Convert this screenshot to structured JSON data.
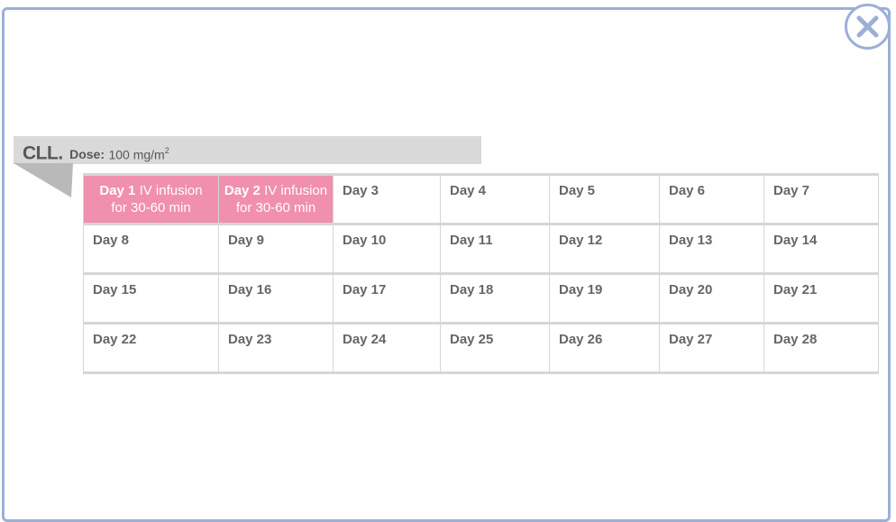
{
  "dialog": {
    "close_icon": "close-x-icon"
  },
  "banner": {
    "title": "CLL.",
    "dose_label": "Dose:",
    "dose_value": "100 mg/m",
    "dose_superscript": "2"
  },
  "schedule": {
    "infusion_text": "IV infusion",
    "duration_text": "for 30-60 min",
    "rows": [
      [
        "Day 1",
        "Day 2",
        "Day 3",
        "Day 4",
        "Day 5",
        "Day 6",
        "Day 7"
      ],
      [
        "Day 8",
        "Day 9",
        "Day 10",
        "Day 11",
        "Day 12",
        "Day 13",
        "Day 14"
      ],
      [
        "Day 15",
        "Day 16",
        "Day 17",
        "Day 18",
        "Day 19",
        "Day 20",
        "Day 21"
      ],
      [
        "Day 22",
        "Day 23",
        "Day 24",
        "Day 25",
        "Day 26",
        "Day 27",
        "Day 28"
      ]
    ],
    "highlight_color": "#f08fae"
  },
  "colors": {
    "accent": "#9cafd7",
    "banner": "#d9d9da",
    "text": "#666669"
  }
}
